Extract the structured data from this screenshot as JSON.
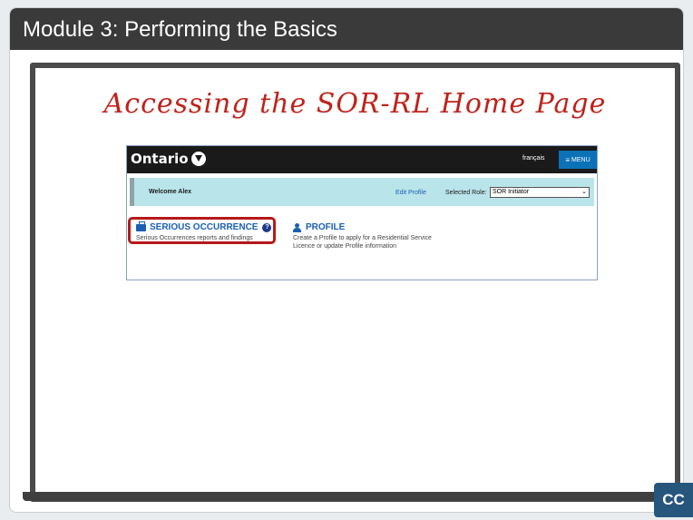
{
  "module": {
    "title": "Module 3:  Performing the Basics"
  },
  "slide": {
    "heading": "Accessing the SOR-RL Home Page"
  },
  "portal": {
    "logo_text": "Ontario",
    "language_link": "français",
    "menu_label": "MENU",
    "welcome": "Welcome Alex",
    "edit_profile": "Edit Profile",
    "role_label": "Selected Role:",
    "role_value": "SOR Initiator",
    "tiles": [
      {
        "title": "SERIOUS OCCURRENCE",
        "description": "Serious Occurrences reports and findings",
        "icon": "briefcase-icon"
      },
      {
        "title": "PROFILE",
        "description": "Create a Profile to apply for a Residential Service Licence or update Profile information",
        "icon": "user-icon"
      }
    ]
  },
  "cc_label": "CC",
  "colors": {
    "heading": "#c0221a",
    "link": "#1a5fb4",
    "highlight": "#b51a1a",
    "menu": "#0b72b8",
    "band": "#b9e4ea",
    "cc": "#27567d"
  }
}
